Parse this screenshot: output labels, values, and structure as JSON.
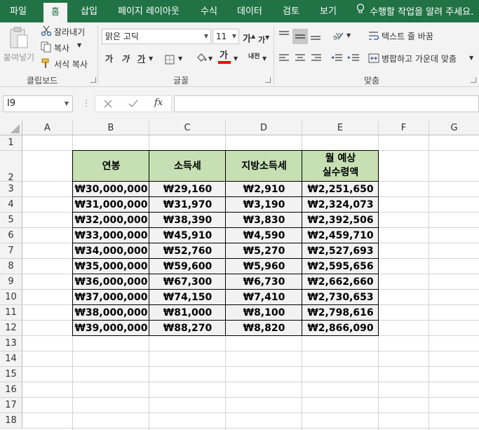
{
  "ribbon": {
    "tabs": [
      "파일",
      "홈",
      "삽입",
      "페이지 레이아웃",
      "수식",
      "데이터",
      "검토",
      "보기"
    ],
    "active_tab": "홈",
    "tell_me": "수행할 작업을 알려 주세요.",
    "clipboard": {
      "paste_label": "붙여넣기",
      "cut_label": "잘라내기",
      "copy_label": "복사",
      "format_painter_label": "서식 복사",
      "group_label": "클립보드"
    },
    "font": {
      "font_name": "맑은 고딕",
      "font_size": "11",
      "grow_font": "가",
      "shrink_font": "가",
      "bold": "가",
      "italic": "가",
      "underline": "가",
      "font_color_glyph": "가",
      "phonetic_glyph": "내천",
      "group_label": "글꼴"
    },
    "alignment": {
      "wrap_text_label": "텍스트 줄 바꿈",
      "merge_center_label": "병합하고 가운데 맞춤",
      "group_label": "맞춤"
    },
    "colors": {
      "ribbon_green": "#217346",
      "header_fill": "#c6e0b4",
      "data_fill": "#f2f2f2",
      "font_color_bar": "#ff0000"
    }
  },
  "formula_bar": {
    "name_box": "I9",
    "fx_label": "fx",
    "formula": ""
  },
  "sheet": {
    "columns": [
      "A",
      "B",
      "C",
      "D",
      "E",
      "F",
      "G"
    ],
    "rows": [
      "1",
      "2",
      "3",
      "4",
      "5",
      "6",
      "7",
      "8",
      "9",
      "10",
      "11",
      "12",
      "13",
      "14",
      "15",
      "16",
      "17",
      "18"
    ],
    "table": {
      "headers": [
        "연봉",
        "소득세",
        "지방소득세",
        "월 예상",
        "실수령액"
      ],
      "data": [
        [
          "₩30,000,000",
          "₩29,160",
          "₩2,910",
          "₩2,251,650"
        ],
        [
          "₩31,000,000",
          "₩31,970",
          "₩3,190",
          "₩2,324,073"
        ],
        [
          "₩32,000,000",
          "₩38,390",
          "₩3,830",
          "₩2,392,506"
        ],
        [
          "₩33,000,000",
          "₩45,910",
          "₩4,590",
          "₩2,459,710"
        ],
        [
          "₩34,000,000",
          "₩52,760",
          "₩5,270",
          "₩2,527,693"
        ],
        [
          "₩35,000,000",
          "₩59,600",
          "₩5,960",
          "₩2,595,656"
        ],
        [
          "₩36,000,000",
          "₩67,300",
          "₩6,730",
          "₩2,662,660"
        ],
        [
          "₩37,000,000",
          "₩74,150",
          "₩7,410",
          "₩2,730,653"
        ],
        [
          "₩38,000,000",
          "₩81,000",
          "₩8,100",
          "₩2,798,616"
        ],
        [
          "₩39,000,000",
          "₩88,270",
          "₩8,820",
          "₩2,866,090"
        ]
      ]
    }
  }
}
